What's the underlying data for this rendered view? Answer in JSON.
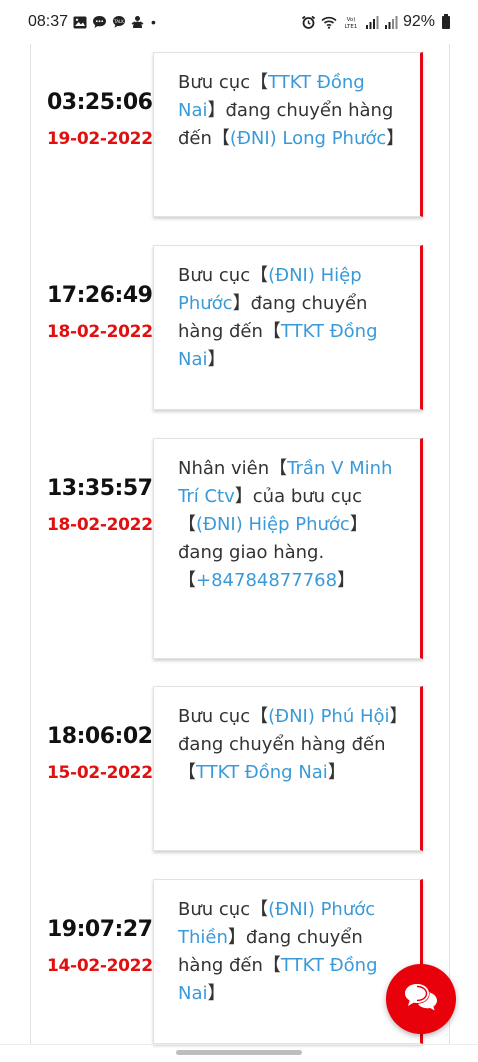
{
  "status_bar": {
    "time": "08:37",
    "left_icons": [
      "image-icon",
      "message-icon",
      "talk-icon",
      "app-icon"
    ],
    "dot": "•",
    "battery": "92%"
  },
  "entries": [
    {
      "time": "03:25:06",
      "date": "19-02-2022",
      "segments": [
        {
          "t": "Bưu cục【",
          "link": false
        },
        {
          "t": "TTKT Đồng Nai",
          "link": true
        },
        {
          "t": "】đang chuyển hàng đến【",
          "link": false
        },
        {
          "t": "(ĐNI) Long Phước",
          "link": true
        },
        {
          "t": "】",
          "link": false
        }
      ]
    },
    {
      "time": "17:26:49",
      "date": "18-02-2022",
      "segments": [
        {
          "t": "Bưu cục【",
          "link": false
        },
        {
          "t": "(ĐNI) Hiệp Phước",
          "link": true
        },
        {
          "t": "】đang chuyển hàng đến【",
          "link": false
        },
        {
          "t": "TTKT Đồng Nai",
          "link": true
        },
        {
          "t": "】",
          "link": false
        }
      ]
    },
    {
      "time": "13:35:57",
      "date": "18-02-2022",
      "segments": [
        {
          "t": "Nhân viên【",
          "link": false
        },
        {
          "t": "Trần V Minh Trí Ctv",
          "link": true
        },
        {
          "t": "】của bưu cục 【",
          "link": false
        },
        {
          "t": "(ĐNI) Hiệp Phước",
          "link": true
        },
        {
          "t": "】đang giao hàng. 【",
          "link": false
        },
        {
          "t": "+84784877768",
          "link": true
        },
        {
          "t": "】",
          "link": false
        }
      ]
    },
    {
      "time": "18:06:02",
      "date": "15-02-2022",
      "segments": [
        {
          "t": "Bưu cục【",
          "link": false
        },
        {
          "t": "(ĐNI) Phú Hội",
          "link": true
        },
        {
          "t": "】đang chuyển hàng đến【",
          "link": false
        },
        {
          "t": "TTKT Đồng Nai",
          "link": true
        },
        {
          "t": "】",
          "link": false
        }
      ]
    },
    {
      "time": "19:07:27",
      "date": "14-02-2022",
      "segments": [
        {
          "t": "Bưu cục【",
          "link": false
        },
        {
          "t": "(ĐNI) Phước Thiền",
          "link": true
        },
        {
          "t": "】đang chuyển hàng đến【",
          "link": false
        },
        {
          "t": "TTKT Đồng Nai",
          "link": true
        },
        {
          "t": "】",
          "link": false
        }
      ]
    }
  ],
  "colors": {
    "time": "#111111",
    "date": "#e01010",
    "link": "#3a9ad9",
    "card_accent": "#e30613",
    "fab": "#e8000b"
  },
  "chat_fab": {
    "icon": "chat-bubbles-icon"
  }
}
